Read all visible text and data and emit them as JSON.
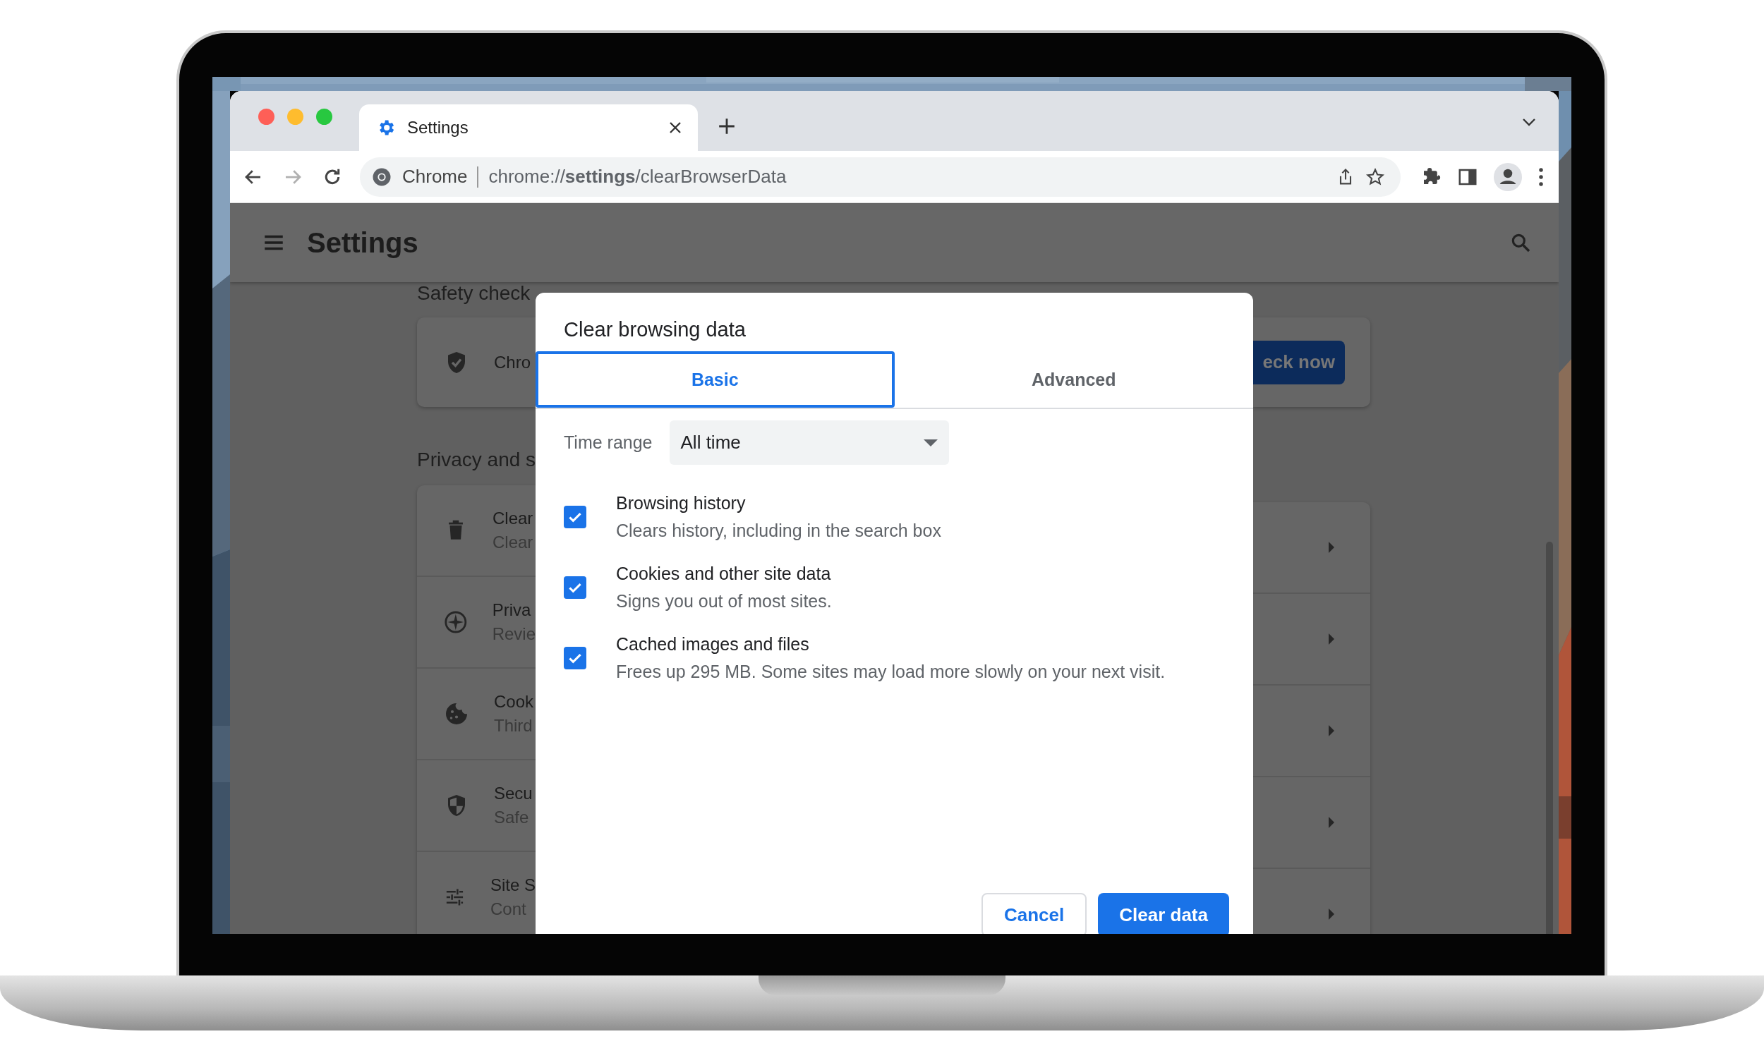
{
  "browser": {
    "tabs": [
      {
        "title": "Settings",
        "selected": true
      }
    ],
    "nav_buttons": [
      {
        "disabled": false
      },
      {
        "disabled": true
      },
      {
        "disabled": false
      }
    ],
    "omnibox": {
      "site_label": "Chrome",
      "url": "chrome://**settings**/clearBrowserData"
    }
  },
  "settings": {
    "title": "Settings",
    "safety_heading": "Safety check",
    "safety_card": {
      "text": "Chro",
      "button": "eck now"
    },
    "privacy_heading": "Privacy and s",
    "rows": [
      {
        "title": "Clear",
        "subtitle": "Clear"
      },
      {
        "title": "Priva",
        "subtitle": "Revie"
      },
      {
        "title": "Cook",
        "subtitle": "Third"
      },
      {
        "title": "Secu",
        "subtitle": "Safe"
      },
      {
        "title": "Site S",
        "subtitle": "Cont"
      }
    ]
  },
  "dialog": {
    "title": "Clear browsing data",
    "tabs": [
      {
        "label": "Basic",
        "selected": true
      },
      {
        "label": "Advanced",
        "selected": false
      }
    ],
    "time_range": {
      "label": "Time range",
      "value": "All time"
    },
    "options": [
      {
        "title": "Browsing history",
        "description": "Clears history, including in the search box",
        "checked": true
      },
      {
        "title": "Cookies and other site data",
        "description": "Signs you out of most sites.",
        "checked": true
      },
      {
        "title": "Cached images and files",
        "description": "Frees up 295 MB. Some sites may load more slowly on your next visit.",
        "checked": true
      }
    ],
    "buttons": [
      {
        "label": "Cancel",
        "kind": "secondary"
      },
      {
        "label": "Clear data",
        "kind": "primary"
      }
    ]
  }
}
